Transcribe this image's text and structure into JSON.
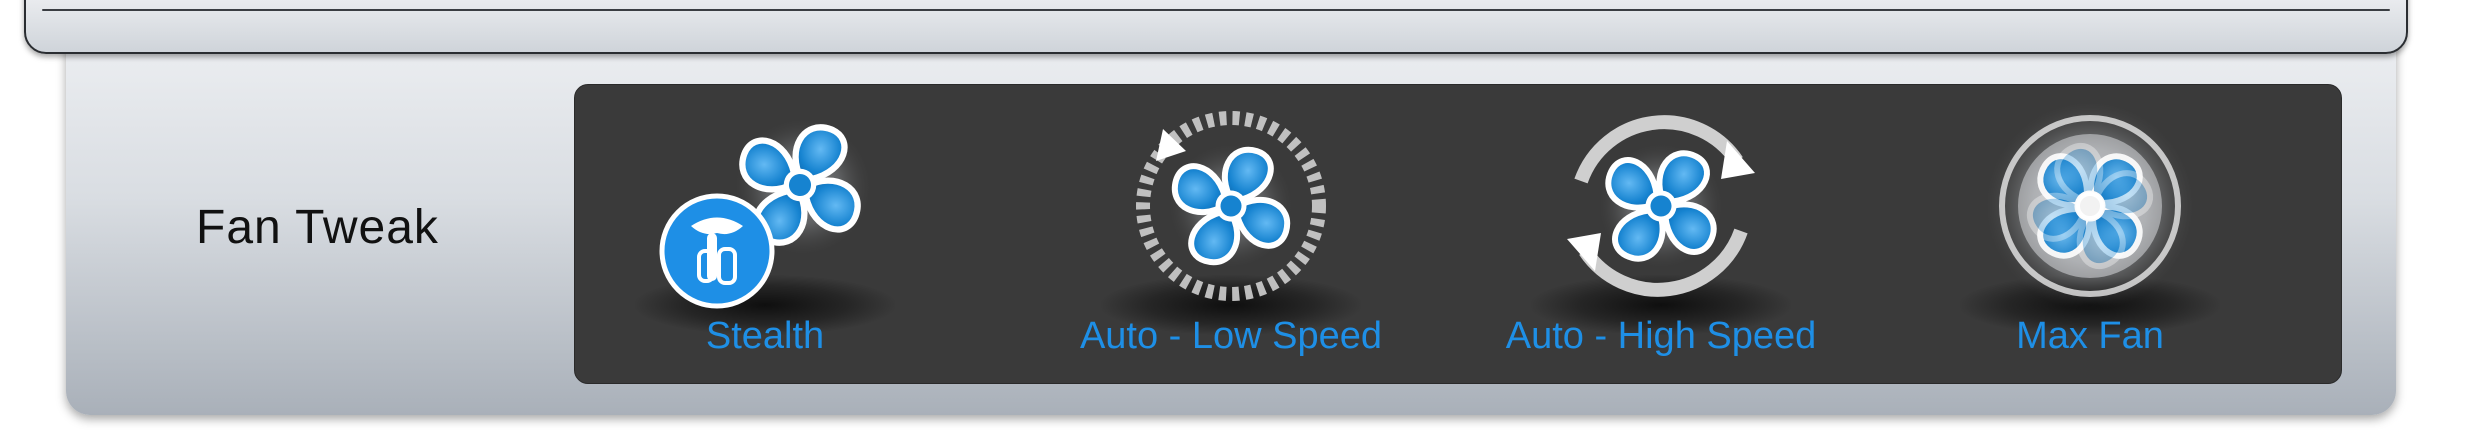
{
  "section": {
    "title": "Fan Tweak"
  },
  "modes": [
    {
      "label": "Stealth",
      "icon": "fan-stealth-icon"
    },
    {
      "label": "Auto - Low Speed",
      "icon": "fan-auto-low-icon"
    },
    {
      "label": "Auto - High Speed",
      "icon": "fan-auto-high-icon"
    },
    {
      "label": "Max Fan",
      "icon": "fan-max-icon"
    }
  ],
  "colors": {
    "accent": "#1e8fe6",
    "panel_dark": "#3a3a3a",
    "fan_blue": "#1683d0"
  }
}
